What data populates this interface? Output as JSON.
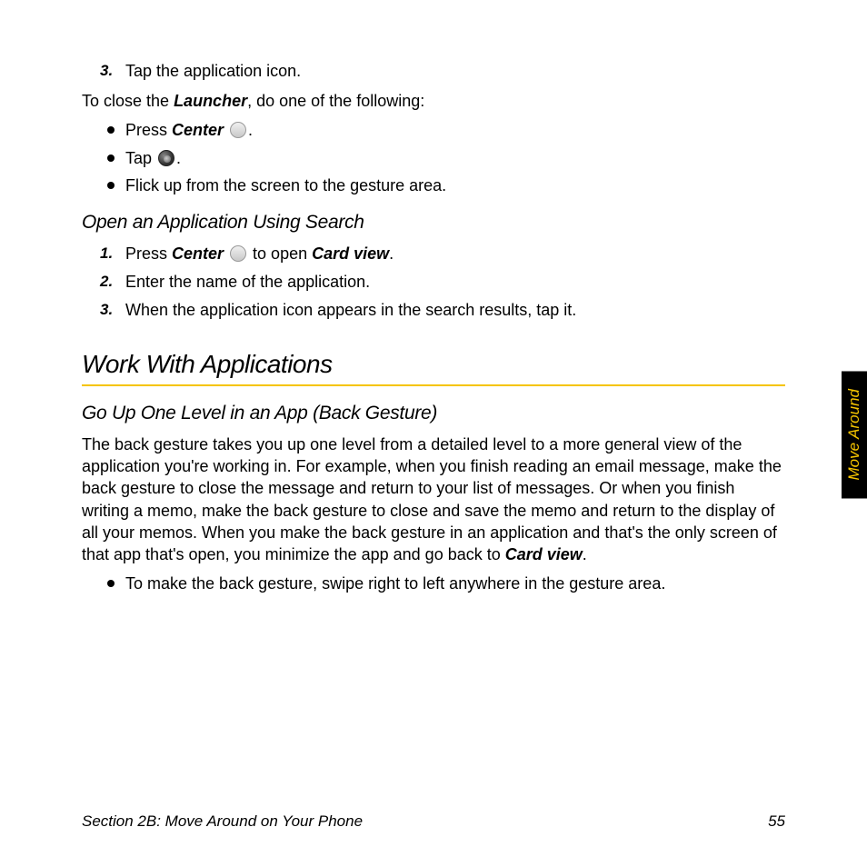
{
  "top": {
    "step3_num": "3.",
    "step3_text": "Tap the application icon.",
    "close_intro_pre": "To close the ",
    "close_intro_em": "Launcher",
    "close_intro_post": ", do one of the following:",
    "b1_pre": "Press ",
    "b1_em": "Center",
    "b1_post": ".",
    "b2_pre": "Tap ",
    "b2_post": ".",
    "b3": "Flick up from the screen to the gesture area."
  },
  "search": {
    "heading": "Open an Application Using Search",
    "s1_num": "1.",
    "s1_pre": "Press ",
    "s1_em1": "Center",
    "s1_mid": " to open ",
    "s1_em2": "Card view",
    "s1_post": ".",
    "s2_num": "2.",
    "s2": "Enter the name of the application.",
    "s3_num": "3.",
    "s3": "When the application icon appears in the search results, tap it."
  },
  "work": {
    "heading": "Work With Applications"
  },
  "back": {
    "heading": "Go Up One Level in an App (Back Gesture)",
    "para_pre": "The back gesture takes you up one level from a detailed level to a more general view of the application you're working in. For example, when you finish reading an email message, make the back gesture to close the message and return to your list of messages. Or when you finish writing a memo, make the back gesture to close and save the memo and return to the display of all your memos. When you make the back gesture in an application and that's the only screen of that app that's open, you minimize the app and go back to ",
    "para_em": "Card view",
    "para_post": ".",
    "bullet": "To make the back gesture, swipe right to left anywhere in the gesture area."
  },
  "sidetab": "Move Around",
  "footer": {
    "left": "Section 2B: Move Around on Your Phone",
    "right": "55"
  }
}
